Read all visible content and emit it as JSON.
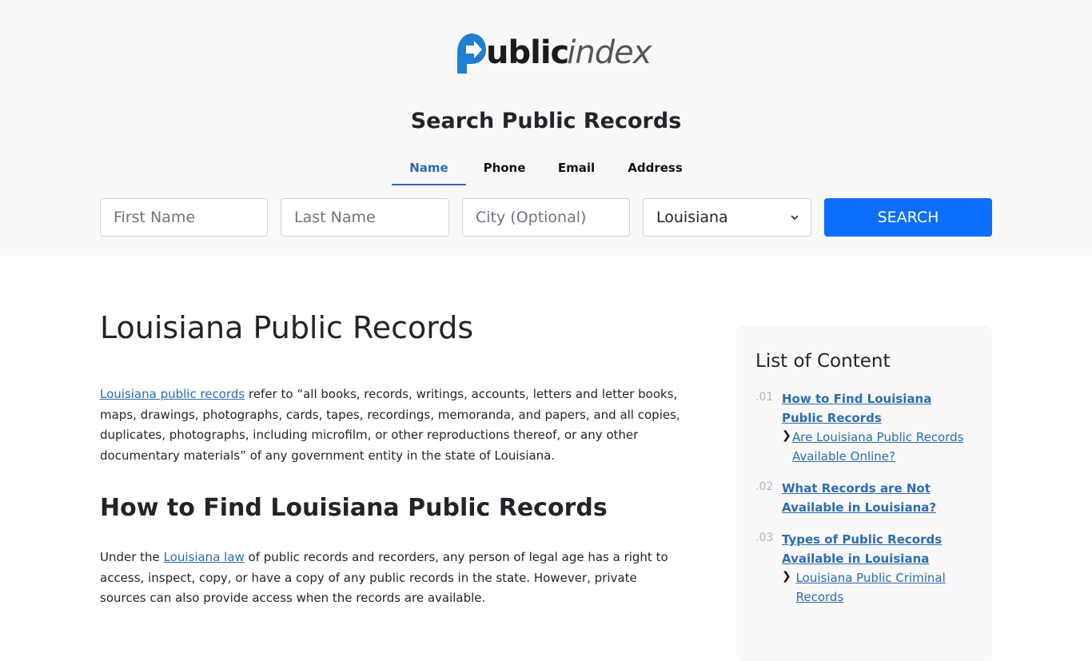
{
  "logo": {
    "part1": "ublic",
    "part2": "index"
  },
  "search": {
    "title": "Search Public Records",
    "tabs": [
      "Name",
      "Phone",
      "Email",
      "Address"
    ],
    "first_name_placeholder": "First Name",
    "last_name_placeholder": "Last Name",
    "city_placeholder": "City (Optional)",
    "state_selected": "Louisiana",
    "button_label": "SEARCH"
  },
  "article": {
    "title": "Louisiana Public Records",
    "intro_link": "Louisiana public records",
    "intro_text": " refer to “all books, records, writings, accounts, letters and letter books, maps, drawings, photographs, cards, tapes, recordings, memoranda, and papers, and all copies, duplicates, photographs, including microfilm, or other reproductions thereof, or any other documentary materials” of any government entity in the state of Louisiana.",
    "section_heading": "How to Find Louisiana Public Records",
    "para2_pre": "Under the ",
    "para2_link": "Louisiana law",
    "para2_post": " of public records and recorders, any person of legal age has a right to access, inspect, copy, or have a copy of any public records in the state. However, private sources can also provide access when the records are available."
  },
  "toc": {
    "title": "List of Content",
    "items": [
      {
        "num": ".01",
        "label": "How to Find Louisiana Public Records",
        "sub": [
          "Are Louisiana Public Records Available Online?"
        ]
      },
      {
        "num": ".02",
        "label": "What Records are Not Available in Louisiana?",
        "sub": []
      },
      {
        "num": ".03",
        "label": "Types of Public Records Available in Louisiana",
        "sub": [
          "Louisiana Public Criminal Records"
        ]
      }
    ]
  },
  "colors": {
    "accent": "#0d6efd",
    "link": "#2c6cb0",
    "logo_blue": "#1f7fd1"
  }
}
